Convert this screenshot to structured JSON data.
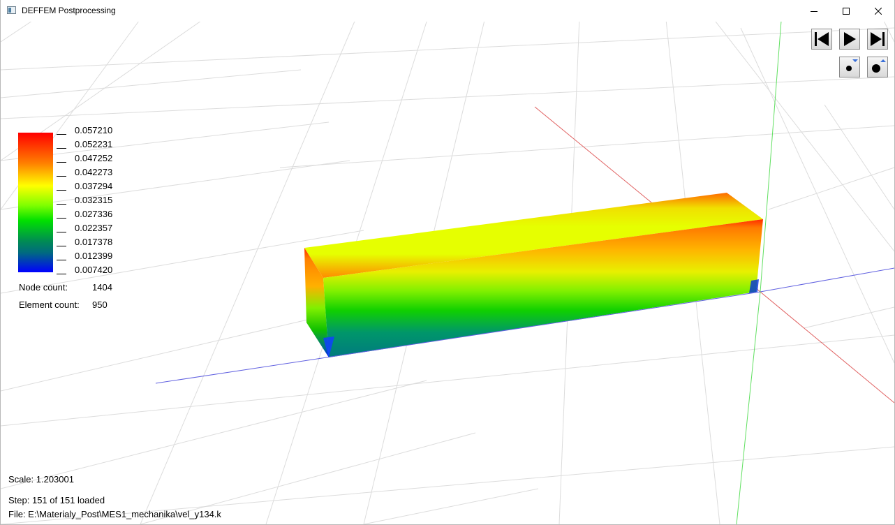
{
  "window": {
    "title": "DEFFEM Postprocessing",
    "minimize_icon": "minimize-icon",
    "maximize_icon": "maximize-icon",
    "close_icon": "close-icon"
  },
  "legend": {
    "values": [
      "0.057210",
      "0.052231",
      "0.047252",
      "0.042273",
      "0.037294",
      "0.032315",
      "0.027336",
      "0.022357",
      "0.017378",
      "0.012399",
      "0.007420"
    ],
    "colors": {
      "max": "#ff0000",
      "high": "#ff8000",
      "mid_high": "#ffff00",
      "mid": "#00e000",
      "low": "#006a80",
      "min": "#0000ff"
    }
  },
  "info": {
    "node_count_label": "Node count:",
    "node_count_value": "1404",
    "element_count_label": "Element count:",
    "element_count_value": "950"
  },
  "controls": {
    "first_icon": "skip-to-start-icon",
    "play_icon": "play-icon",
    "last_icon": "skip-to-end-icon",
    "point_smaller_icon": "point-size-decrease-icon",
    "point_larger_icon": "point-size-increase-icon"
  },
  "status": {
    "scale": "Scale: 1.203001",
    "step": "Step: 151 of 151 loaded",
    "file": "File: E:\\Materialy_Post\\MES1_mechanika\\vel_y134.k"
  },
  "scene": {
    "axis_colors": {
      "x": "#e06060",
      "y": "#60e060",
      "z": "#6060e0"
    },
    "grid_color": "#d8d8d8"
  }
}
